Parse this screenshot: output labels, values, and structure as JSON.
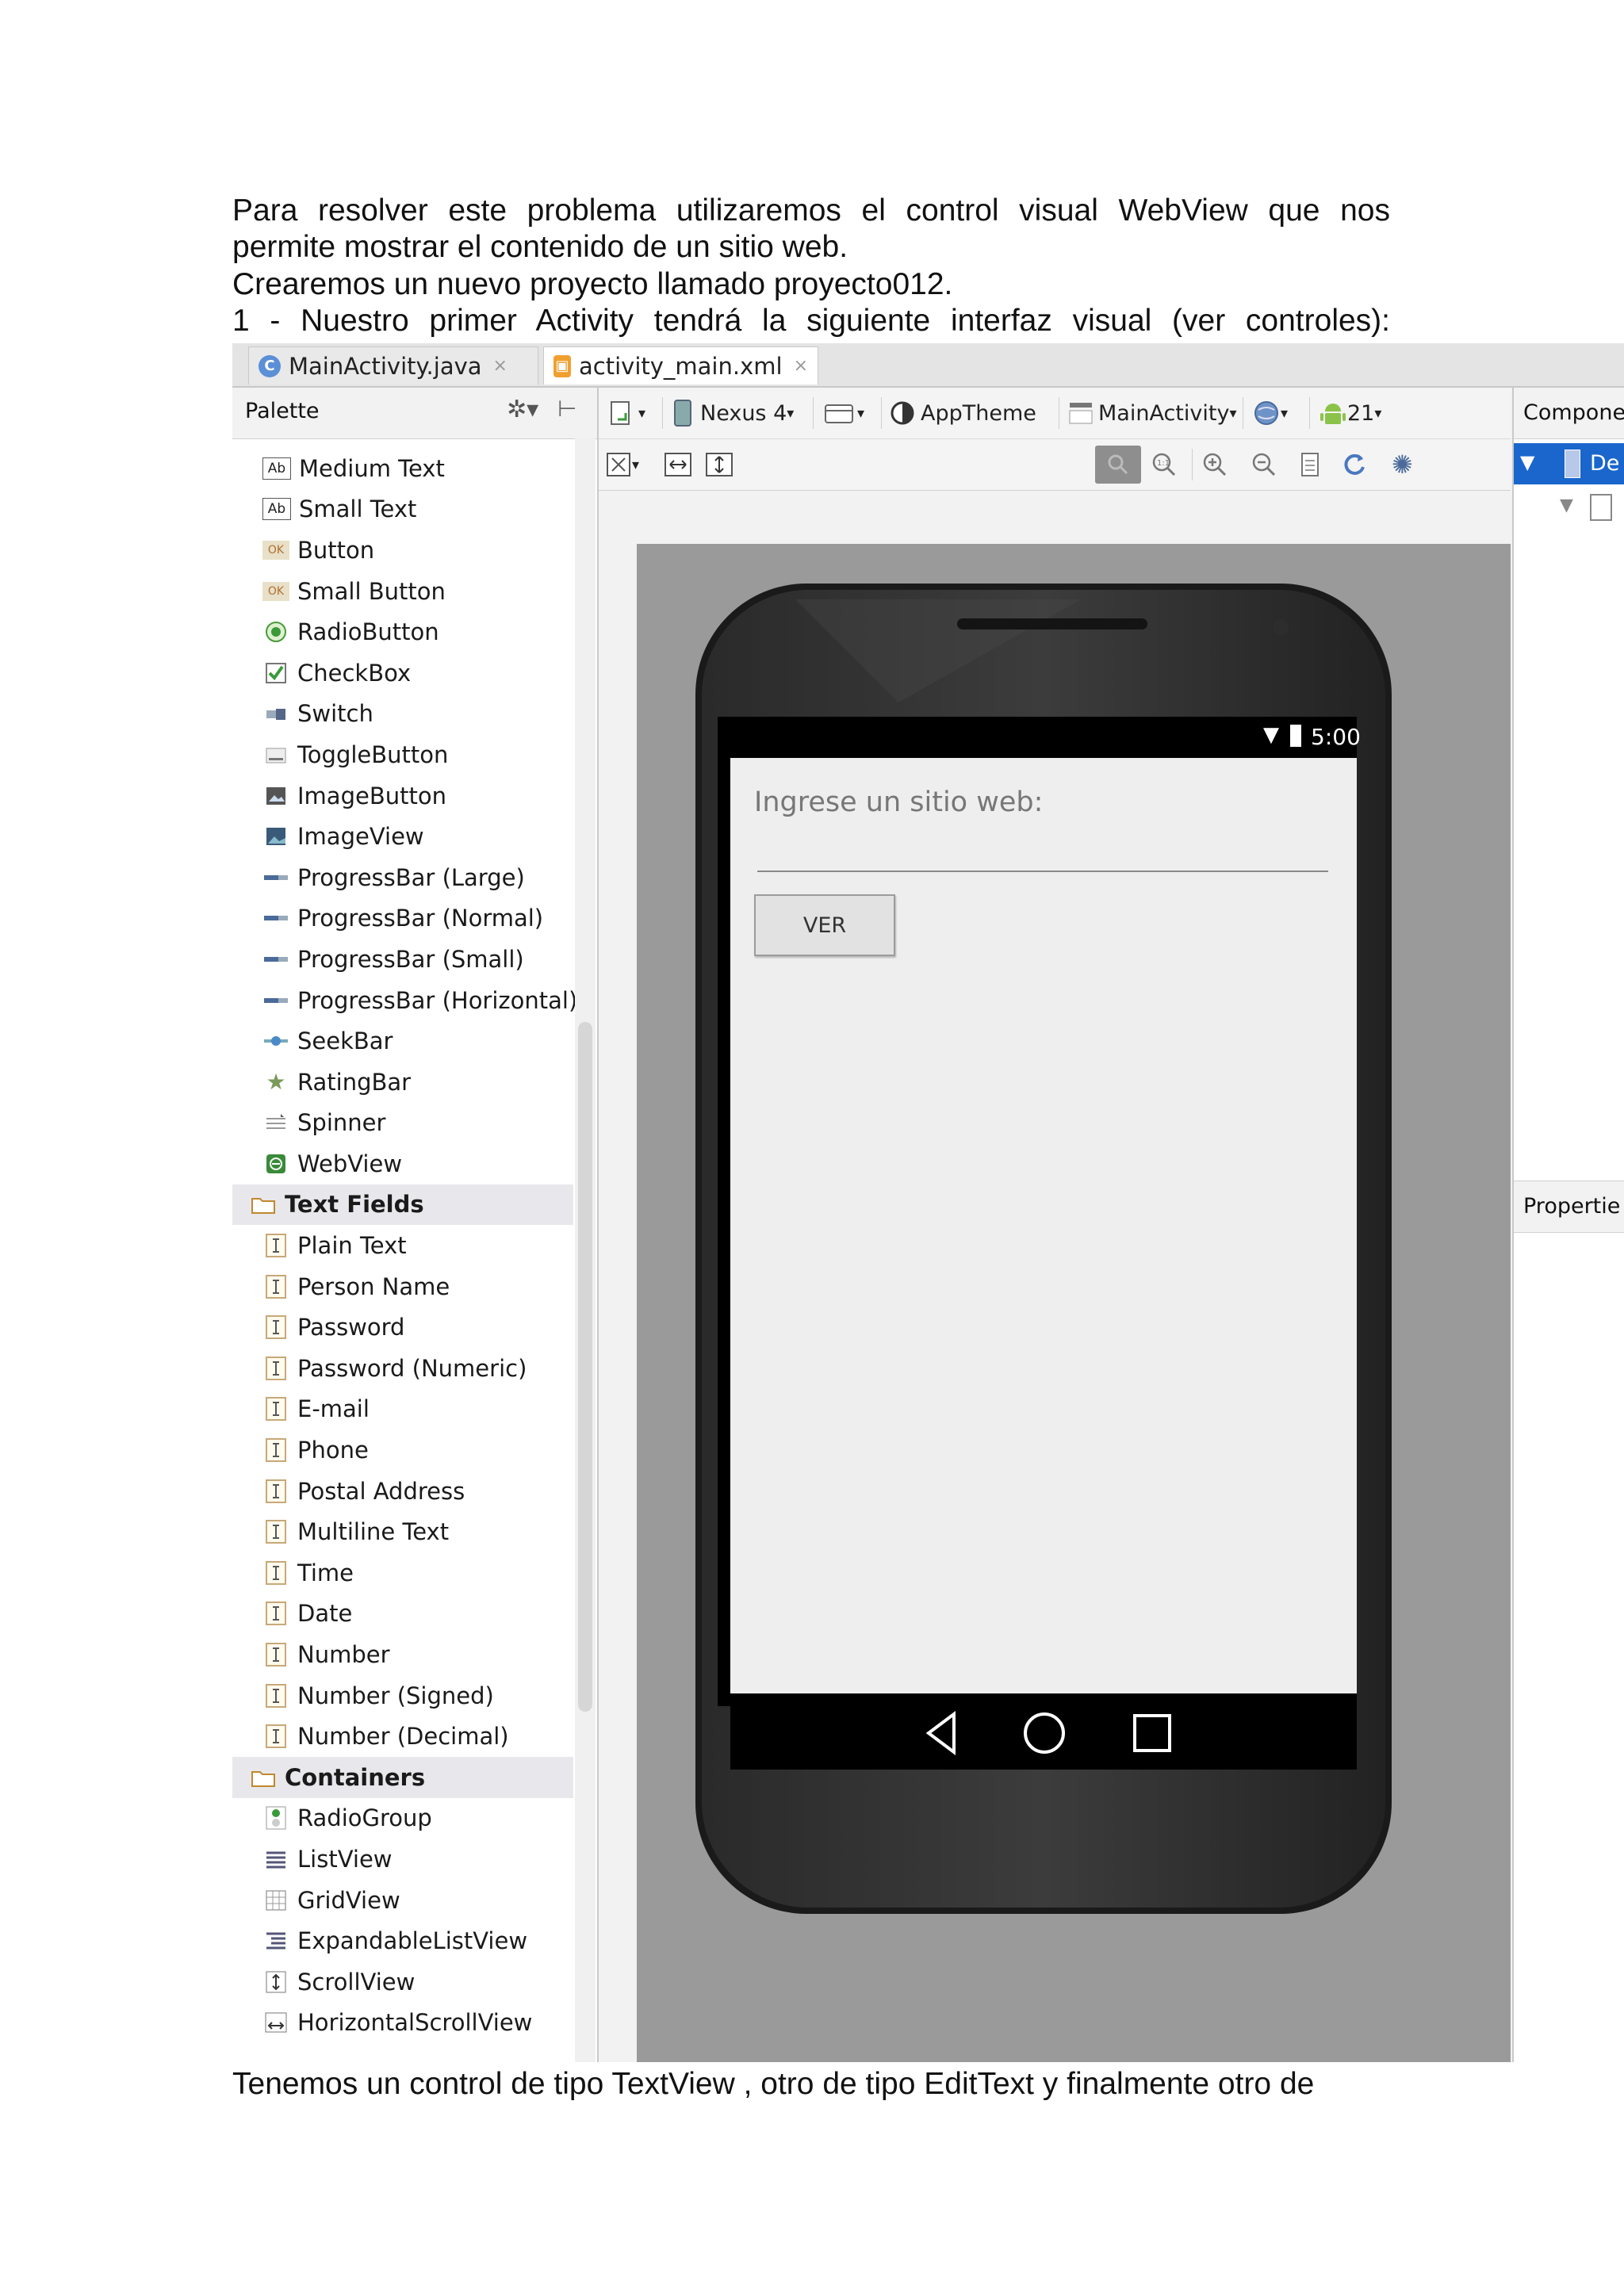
{
  "document": {
    "paragraph_lines": [
      "Para resolver este problema utilizaremos el control visual WebView que nos",
      "permite mostrar el contenido de un sitio web."
    ],
    "line2": "Crearemos un nuevo proyecto llamado proyecto012.",
    "line3": "1 - Nuestro primer Activity tendrá la siguiente interfaz visual (ver controles):",
    "footer_line": "Tenemos un control de tipo TextView , otro de tipo EditText y finalmente otro de"
  },
  "ide": {
    "tabs": [
      {
        "label": "MainActivity.java",
        "close": "×",
        "icon": "java-class-icon"
      },
      {
        "label": "activity_main.xml",
        "close": "×",
        "icon": "xml-layout-icon"
      }
    ],
    "palette": {
      "title": "Palette",
      "items": [
        {
          "label": "Medium Text",
          "icon": "ab-text-icon"
        },
        {
          "label": "Small Text",
          "icon": "ab-text-icon"
        },
        {
          "label": "Button",
          "icon": "ok-button-icon"
        },
        {
          "label": "Small Button",
          "icon": "ok-button-icon"
        },
        {
          "label": "RadioButton",
          "icon": "radio-icon"
        },
        {
          "label": "CheckBox",
          "icon": "checkbox-icon"
        },
        {
          "label": "Switch",
          "icon": "switch-icon"
        },
        {
          "label": "ToggleButton",
          "icon": "toggle-icon"
        },
        {
          "label": "ImageButton",
          "icon": "image-button-icon"
        },
        {
          "label": "ImageView",
          "icon": "image-view-icon"
        },
        {
          "label": "ProgressBar (Large)",
          "icon": "progress-icon"
        },
        {
          "label": "ProgressBar (Normal)",
          "icon": "progress-icon"
        },
        {
          "label": "ProgressBar (Small)",
          "icon": "progress-icon"
        },
        {
          "label": "ProgressBar (Horizontal)",
          "icon": "progress-icon"
        },
        {
          "label": "SeekBar",
          "icon": "seekbar-icon"
        },
        {
          "label": "RatingBar",
          "icon": "star-icon"
        },
        {
          "label": "Spinner",
          "icon": "spinner-icon"
        },
        {
          "label": "WebView",
          "icon": "web-icon"
        },
        {
          "label": "Text Fields",
          "icon": "folder-icon",
          "category": true
        },
        {
          "label": "Plain Text",
          "icon": "text-field-icon"
        },
        {
          "label": "Person Name",
          "icon": "text-field-icon"
        },
        {
          "label": "Password",
          "icon": "text-field-icon"
        },
        {
          "label": "Password (Numeric)",
          "icon": "text-field-icon"
        },
        {
          "label": "E-mail",
          "icon": "text-field-icon"
        },
        {
          "label": "Phone",
          "icon": "text-field-icon"
        },
        {
          "label": "Postal Address",
          "icon": "text-field-icon"
        },
        {
          "label": "Multiline Text",
          "icon": "text-field-icon"
        },
        {
          "label": "Time",
          "icon": "text-field-icon"
        },
        {
          "label": "Date",
          "icon": "text-field-icon"
        },
        {
          "label": "Number",
          "icon": "text-field-icon"
        },
        {
          "label": "Number (Signed)",
          "icon": "text-field-icon"
        },
        {
          "label": "Number (Decimal)",
          "icon": "text-field-icon"
        },
        {
          "label": "Containers",
          "icon": "folder-icon",
          "category": true
        },
        {
          "label": "RadioGroup",
          "icon": "radio-group-icon"
        },
        {
          "label": "ListView",
          "icon": "list-icon"
        },
        {
          "label": "GridView",
          "icon": "grid-icon"
        },
        {
          "label": "ExpandableListView",
          "icon": "expandable-list-icon"
        },
        {
          "label": "ScrollView",
          "icon": "scroll-icon"
        },
        {
          "label": "HorizontalScrollView",
          "icon": "hscroll-icon"
        }
      ]
    },
    "toolbar": {
      "device": "Nexus 4",
      "theme": "AppTheme",
      "activity": "MainActivity",
      "api": "21"
    },
    "components_title": "Compone",
    "components_item": "De",
    "properties_title": "Propertie",
    "phone": {
      "status_time": "5:00",
      "text_view": "Ingrese un sitio web:",
      "button": "VER"
    }
  }
}
